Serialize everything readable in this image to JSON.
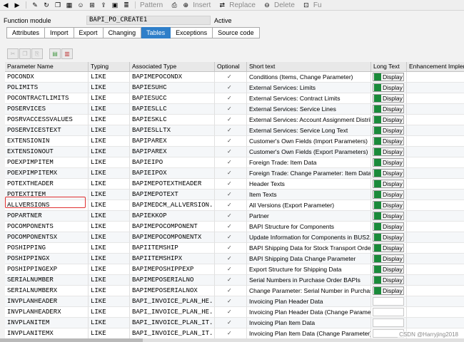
{
  "toolbar": {
    "icons": [
      "back-icon",
      "forward-icon",
      "inspect-icon",
      "history-icon",
      "copy-icon",
      "object-list-icon",
      "user-icon",
      "hierarchy-icon",
      "upload-icon",
      "display-icon",
      "list-icon"
    ],
    "pattern": "Pattern",
    "insert": "Insert",
    "replace": "Replace",
    "delete": "Delete",
    "more": "Fu"
  },
  "header": {
    "label": "Function module",
    "value": "BAPI_PO_CREATE1",
    "status": "Active"
  },
  "tabs": [
    {
      "label": "Attributes",
      "active": false
    },
    {
      "label": "Import",
      "active": false
    },
    {
      "label": "Export",
      "active": false
    },
    {
      "label": "Changing",
      "active": false
    },
    {
      "label": "Tables",
      "active": true
    },
    {
      "label": "Exceptions",
      "active": false
    },
    {
      "label": "Source code",
      "active": false
    }
  ],
  "columns": {
    "param": "Parameter Name",
    "typing": "Typing",
    "assoc": "Associated Type",
    "optional": "Optional",
    "short": "Short text",
    "long": "Long Text",
    "enh": "Enhancement Impleme"
  },
  "display_label": "Display",
  "rows": [
    {
      "param": "POCONDX",
      "typing": "LIKE",
      "assoc": "BAPIMEPOCONDX",
      "short": "Conditions (Items, Change Parameter)",
      "display": true
    },
    {
      "param": "POLIMITS",
      "typing": "LIKE",
      "assoc": "BAPIESUHC",
      "short": "External Services: Limits",
      "display": true
    },
    {
      "param": "POCONTRACTLIMITS",
      "typing": "LIKE",
      "assoc": "BAPIESUCC",
      "short": "External Services: Contract Limits",
      "display": true
    },
    {
      "param": "POSERVICES",
      "typing": "LIKE",
      "assoc": "BAPIESLLC",
      "short": "External Services: Service Lines",
      "display": true
    },
    {
      "param": "POSRVACCESSVALUES",
      "typing": "LIKE",
      "assoc": "BAPIESKLC",
      "short": "External Services: Account Assignment Distrib",
      "display": true
    },
    {
      "param": "POSERVICESTEXT",
      "typing": "LIKE",
      "assoc": "BAPIESLLTX",
      "short": "External Services: Service Long Text",
      "display": true
    },
    {
      "param": "EXTENSIONIN",
      "typing": "LIKE",
      "assoc": "BAPIPAREX",
      "short": "Customer's Own Fields (Import Parameters)",
      "display": true
    },
    {
      "param": "EXTENSIONOUT",
      "typing": "LIKE",
      "assoc": "BAPIPAREX",
      "short": "Customer's Own Fields (Export Parameters)",
      "display": true
    },
    {
      "param": "POEXPIMPITEM",
      "typing": "LIKE",
      "assoc": "BAPIEIPO",
      "short": "Foreign Trade: Item Data",
      "display": true
    },
    {
      "param": "POEXPIMPITEMX",
      "typing": "LIKE",
      "assoc": "BAPIEIPOX",
      "short": "Foreign Trade: Change Parameter: Item Data",
      "display": true
    },
    {
      "param": "POTEXTHEADER",
      "typing": "LIKE",
      "assoc": "BAPIMEPOTEXTHEADER",
      "short": "Header Texts",
      "display": true
    },
    {
      "param": "POTEXTITEM",
      "typing": "LIKE",
      "assoc": "BAPIMEPOTEXT",
      "short": "Item Texts",
      "display": true
    },
    {
      "param": "ALLVERSIONS",
      "typing": "LIKE",
      "assoc": "BAPIMEDCM_ALLVERSION...",
      "short": "All Versions (Export Parameter)",
      "display": true
    },
    {
      "param": "POPARTNER",
      "typing": "LIKE",
      "assoc": "BAPIEKKOP",
      "short": "Partner",
      "display": true
    },
    {
      "param": "POCOMPONENTS",
      "typing": "LIKE",
      "assoc": "BAPIMEPOCOMPONENT",
      "short": "BAPI Structure for Components",
      "display": true
    },
    {
      "param": "POCOMPONENTSX",
      "typing": "LIKE",
      "assoc": "BAPIMEPOCOMPONENTX",
      "short": "Update Information for Components in BUS2...",
      "display": true
    },
    {
      "param": "POSHIPPING",
      "typing": "LIKE",
      "assoc": "BAPIITEMSHIP",
      "short": "BAPI Shipping Data for Stock Transport Orde...",
      "display": true
    },
    {
      "param": "POSHIPPINGX",
      "typing": "LIKE",
      "assoc": "BAPIITEMSHIPX",
      "short": "BAPI Shipping Data Change Parameter",
      "display": true
    },
    {
      "param": "POSHIPPINGEXP",
      "typing": "LIKE",
      "assoc": "BAPIMEPOSHIPPEXP",
      "short": "Export Structure for Shipping Data",
      "display": true
    },
    {
      "param": "SERIALNUMBER",
      "typing": "LIKE",
      "assoc": "BAPIMEPOSERIALNO",
      "short": "Serial Numbers in Purchase Order BAPIs",
      "display": true
    },
    {
      "param": "SERIALNUMBERX",
      "typing": "LIKE",
      "assoc": "BAPIMEPOSERIALNOX",
      "short": "Change Parameter: Serial Number in Purchas...",
      "display": true
    },
    {
      "param": "INVPLANHEADER",
      "typing": "LIKE",
      "assoc": "BAPI_INVOICE_PLAN_HE...",
      "short": "Invoicing Plan Header Data",
      "display": false
    },
    {
      "param": "INVPLANHEADERX",
      "typing": "LIKE",
      "assoc": "BAPI_INVOICE_PLAN_HE...",
      "short": "Invoicing Plan Header Data (Change Paramet...",
      "display": false
    },
    {
      "param": "INVPLANITEM",
      "typing": "LIKE",
      "assoc": "BAPI_INVOICE_PLAN_IT...",
      "short": "Invoicing Plan Item Data",
      "display": false
    },
    {
      "param": "INVPLANITEMX",
      "typing": "LIKE",
      "assoc": "BAPI_INVOICE_PLAN_IT...",
      "short": "Invoicing Plan Item Data (Change Parameter)",
      "display": false
    }
  ],
  "watermark": "CSDN @Harryjing2018"
}
